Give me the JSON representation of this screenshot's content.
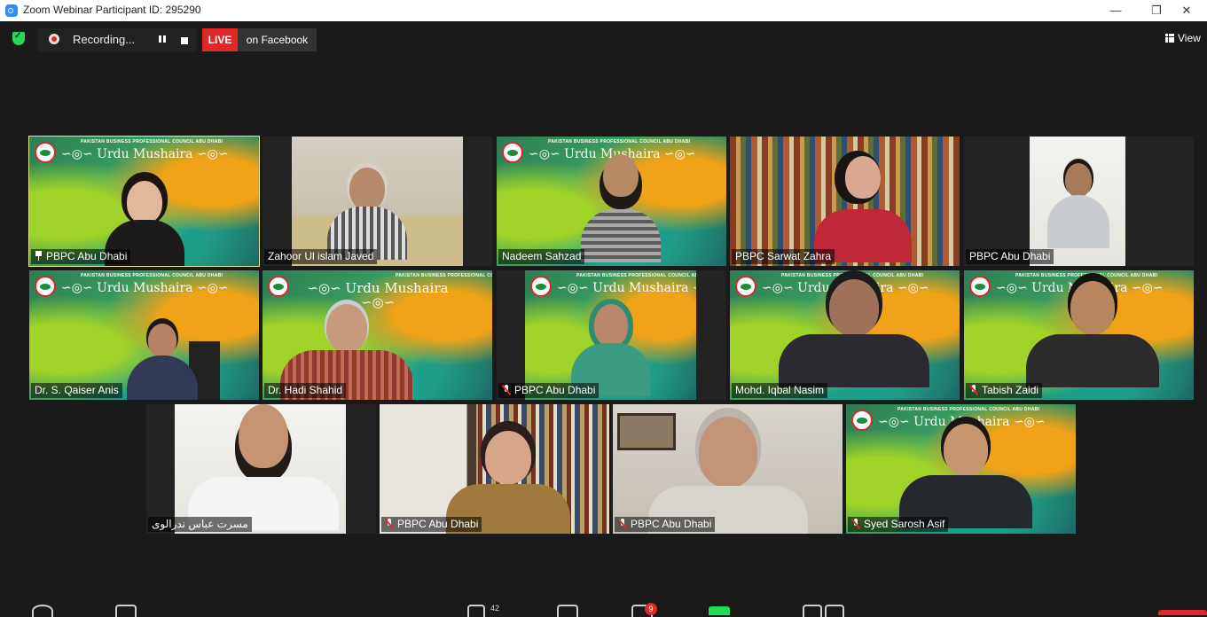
{
  "window": {
    "title": "Zoom Webinar Participant ID: 295290",
    "minimize_glyph": "—",
    "restore_glyph": "❐",
    "close_glyph": "✕"
  },
  "toolbar": {
    "recording_label": "Recording...",
    "live_label": "LIVE",
    "live_destination": "on Facebook",
    "view_label": "View"
  },
  "banner": {
    "title": "Urdu Mushaira",
    "organization": "PAKISTAN BUSINESS PROFESSIONAL COUNCIL ABU DHABI",
    "ornament": "∽◎∽"
  },
  "participants": [
    {
      "name": "PBPC Abu Dhabi",
      "icon": "pin-icon"
    },
    {
      "name": "Zahoor Ul islam Javed",
      "icon": ""
    },
    {
      "name": "Nadeem Sahzad",
      "icon": ""
    },
    {
      "name": "PBPC  Sarwat Zahra",
      "icon": ""
    },
    {
      "name": "PBPC Abu Dhabi",
      "icon": ""
    },
    {
      "name": "Dr. S. Qaiser Anis",
      "icon": ""
    },
    {
      "name": "Dr. Hadi Shahid",
      "icon": ""
    },
    {
      "name": "PBPC Abu Dhabi",
      "icon": "mic-muted-icon"
    },
    {
      "name": "Mohd. Iqbal Nasim",
      "icon": ""
    },
    {
      "name": "Tabish Zaidi",
      "icon": "mic-muted-icon"
    },
    {
      "name": "مسرت عباس ندرالوی",
      "icon": ""
    },
    {
      "name": "PBPC Abu Dhabi",
      "icon": "mic-muted-icon"
    },
    {
      "name": "PBPC Abu Dhabi",
      "icon": "mic-muted-icon"
    },
    {
      "name": "Syed Sarosh Asif",
      "icon": "mic-muted-icon"
    }
  ],
  "bottom_bar": {
    "participants_count": "42",
    "chat_badge": "9"
  },
  "colors": {
    "active_speaker_border": "#e8e78c",
    "live_red": "#e02828",
    "secure_green": "#23d959",
    "meeting_bg": "#1a1a1a"
  }
}
